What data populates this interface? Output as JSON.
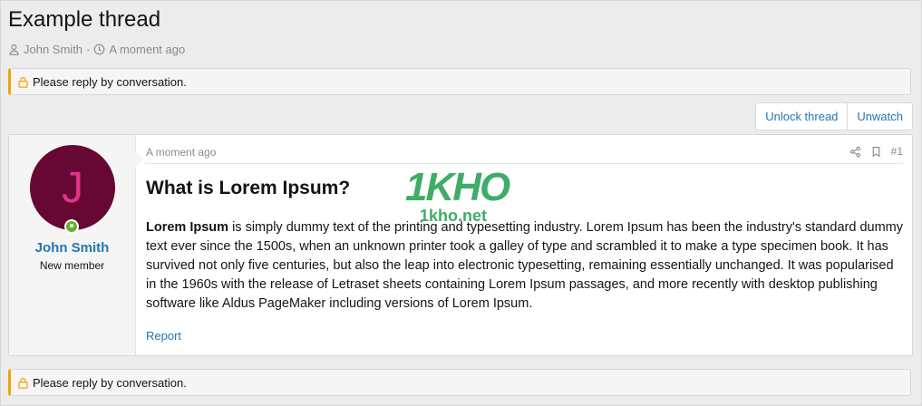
{
  "thread": {
    "title": "Example thread",
    "author": "John Smith",
    "separator": "·",
    "time": "A moment ago"
  },
  "notice": {
    "text": "Please reply by conversation."
  },
  "actions": {
    "unlock": "Unlock thread",
    "unwatch": "Unwatch"
  },
  "post": {
    "user": {
      "initial": "J",
      "name": "John Smith",
      "title": "New member"
    },
    "time": "A moment ago",
    "number": "#1",
    "title": "What is Lorem Ipsum?",
    "body_bold": "Lorem Ipsum",
    "body_rest": " is simply dummy text of the printing and typesetting industry. Lorem Ipsum has been the industry's standard dummy text ever since the 1500s, when an unknown printer took a galley of type and scrambled it to make a type specimen book. It has survived not only five centuries, but also the leap into electronic typesetting, remaining essentially unchanged. It was popularised in the 1960s with the release of Letraset sheets containing Lorem Ipsum passages, and more recently with desktop publishing software like Aldus PageMaker including versions of Lorem Ipsum.",
    "report": "Report"
  },
  "watermark": {
    "brand": "1KHO",
    "domain": "1kho.net"
  },
  "colors": {
    "accent": "#2577b1",
    "notice_bar": "#f0a400",
    "avatar_bg": "#660833",
    "avatar_fg": "#e0348a",
    "online": "#63b32e"
  }
}
